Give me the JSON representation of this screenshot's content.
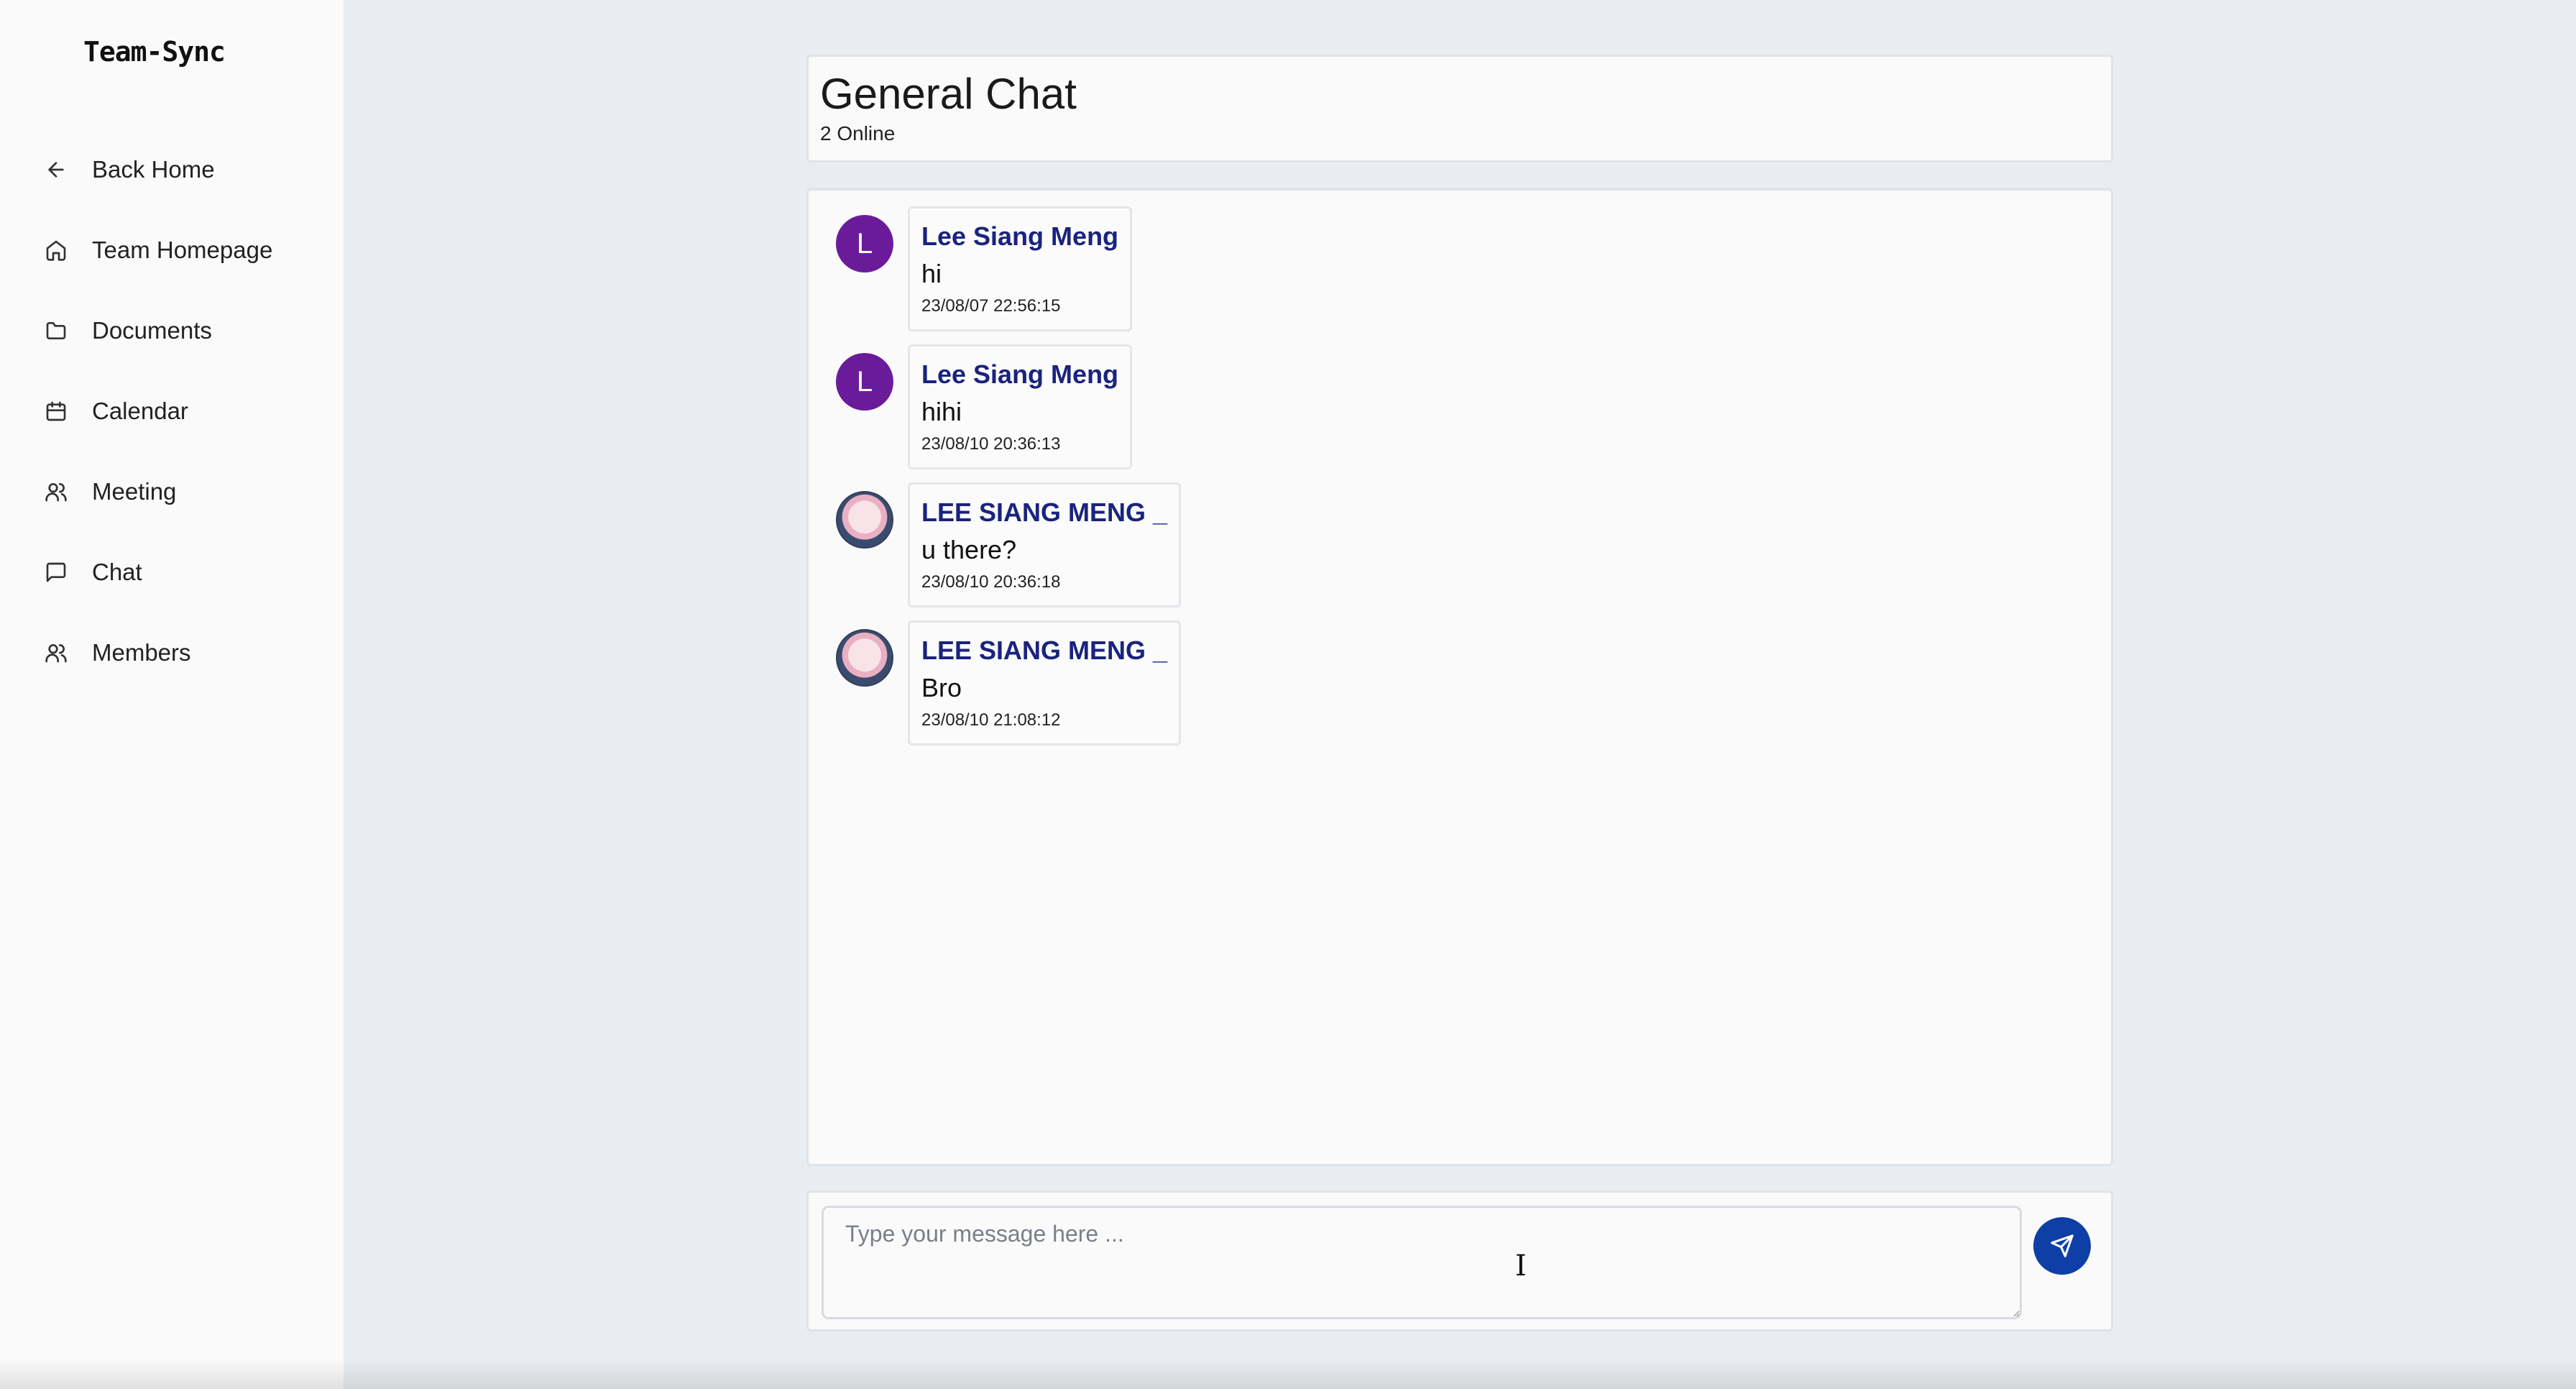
{
  "sidebar": {
    "brand": "Team-Sync",
    "items": [
      {
        "label": "Back Home",
        "icon": "arrow-left-icon"
      },
      {
        "label": "Team Homepage",
        "icon": "home-icon"
      },
      {
        "label": "Documents",
        "icon": "folder-icon"
      },
      {
        "label": "Calendar",
        "icon": "calendar-icon"
      },
      {
        "label": "Meeting",
        "icon": "users-icon"
      },
      {
        "label": "Chat",
        "icon": "message-square-icon"
      },
      {
        "label": "Members",
        "icon": "users-icon"
      }
    ]
  },
  "header": {
    "title": "General Chat",
    "online": "2 Online"
  },
  "messages": [
    {
      "avatar_letter": "L",
      "avatar_type": "letter",
      "sender": "Lee Siang Meng",
      "text": "hi",
      "time": "23/08/07 22:56:15"
    },
    {
      "avatar_letter": "L",
      "avatar_type": "letter",
      "sender": "Lee Siang Meng",
      "text": "hihi",
      "time": "23/08/10 20:36:13"
    },
    {
      "avatar_letter": "",
      "avatar_type": "image",
      "sender": "LEE SIANG MENG _",
      "text": "u there?",
      "time": "23/08/10 20:36:18"
    },
    {
      "avatar_letter": "",
      "avatar_type": "image",
      "sender": "LEE SIANG MENG _",
      "text": "Bro",
      "time": "23/08/10 21:08:12"
    }
  ],
  "composer": {
    "placeholder": "Type your message here ...",
    "value": ""
  },
  "colors": {
    "accent": "#0d3fa6",
    "sender": "#1a237e",
    "avatar_bg": "#6a1b9a"
  }
}
